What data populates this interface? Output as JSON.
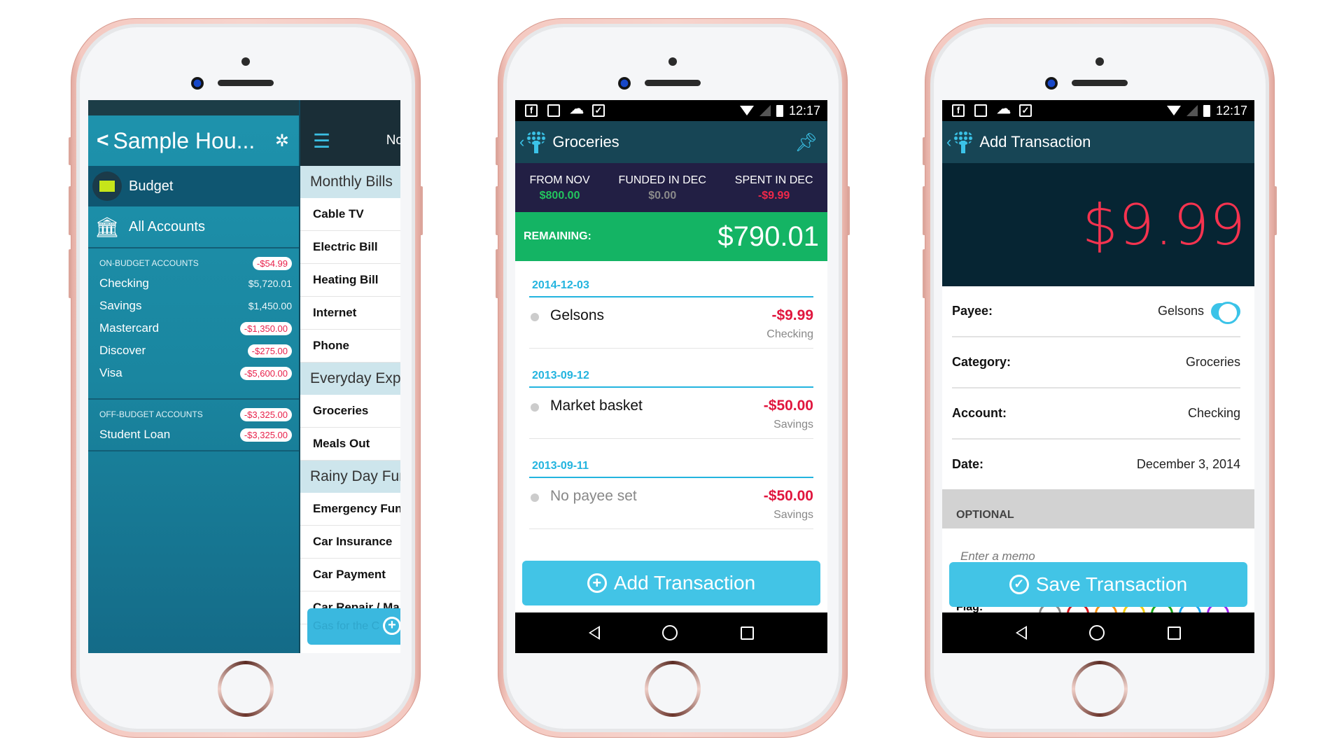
{
  "phone1": {
    "header_title": "Sample Hou...",
    "back_glyph": "<",
    "settings_icon": "gear-icon",
    "nav": [
      {
        "label": "Budget",
        "icon": "envelope-icon",
        "active": true
      },
      {
        "label": "All Accounts",
        "icon": "bank-icon",
        "active": false
      }
    ],
    "on_budget": {
      "heading": "ON-BUDGET ACCOUNTS",
      "total": "-$54.99",
      "accounts": [
        {
          "name": "Checking",
          "balance": "$5,720.01",
          "negative": false
        },
        {
          "name": "Savings",
          "balance": "$1,450.00",
          "negative": false
        },
        {
          "name": "Mastercard",
          "balance": "-$1,350.00",
          "negative": true
        },
        {
          "name": "Discover",
          "balance": "-$275.00",
          "negative": true
        },
        {
          "name": "Visa",
          "balance": "-$5,600.00",
          "negative": true
        }
      ]
    },
    "off_budget": {
      "heading": "OFF-BUDGET ACCOUNTS",
      "total": "-$3,325.00",
      "accounts": [
        {
          "name": "Student Loan",
          "balance": "-$3,325.00",
          "negative": true
        }
      ]
    },
    "right_panel": {
      "header_text": "No",
      "menu_icon": "hamburger-icon",
      "groups": [
        {
          "label": "Monthly Bills",
          "items": [
            "Cable TV",
            "Electric Bill",
            "Heating Bill",
            "Internet",
            "Phone"
          ]
        },
        {
          "label": "Everyday Expe",
          "items": [
            "Groceries",
            "Meals Out"
          ]
        },
        {
          "label": "Rainy Day Fun",
          "items": [
            "Emergency Fun",
            "Car Insurance",
            "Car Payment",
            "Car Repair / Ma"
          ]
        }
      ],
      "add_input_placeholder": "Gas for the C",
      "add_icon": "plus-circle-icon"
    }
  },
  "phone2": {
    "status": {
      "icons": [
        "facebook-icon",
        "image-icon",
        "cloud-upload-icon",
        "clipboard-check-icon"
      ],
      "time": "12:17"
    },
    "appbar_title": "Groceries",
    "pin_icon": "pin-icon",
    "stats": [
      {
        "label": "FROM NOV",
        "value": "$800.00",
        "color": "#22c55e"
      },
      {
        "label": "FUNDED IN DEC",
        "value": "$0.00",
        "color": "#8a8a8a"
      },
      {
        "label": "SPENT IN DEC",
        "value": "-$9.99",
        "color": "#f0284a"
      }
    ],
    "remaining_label": "REMAINING:",
    "remaining_value": "$790.01",
    "transactions": [
      {
        "date": "2014-12-03",
        "payee": "Gelsons",
        "amount": "-$9.99",
        "account": "Checking",
        "no_payee": false
      },
      {
        "date": "2013-09-12",
        "payee": "Market basket",
        "amount": "-$50.00",
        "account": "Savings",
        "no_payee": false
      },
      {
        "date": "2013-09-11",
        "payee": "No payee set",
        "amount": "-$50.00",
        "account": "Savings",
        "no_payee": true
      }
    ],
    "add_button": "Add Transaction"
  },
  "phone3": {
    "status": {
      "icons": [
        "facebook-icon",
        "image-icon",
        "cloud-upload-icon",
        "clipboard-check-icon"
      ],
      "time": "12:17"
    },
    "appbar_title": "Add Transaction",
    "amount": "$9.99",
    "fields": [
      {
        "label": "Payee:",
        "value": "Gelsons"
      },
      {
        "label": "Category:",
        "value": "Groceries"
      },
      {
        "label": "Account:",
        "value": "Checking"
      },
      {
        "label": "Date:",
        "value": "December 3, 2014"
      }
    ],
    "optional_heading": "OPTIONAL",
    "memo_placeholder": "Enter a memo",
    "flag_label": "Flag:",
    "flag_colors": [
      "#888888",
      "#d4141c",
      "#f39012",
      "#f2cc0c",
      "#1aa81a",
      "#1aa4f0",
      "#9b22f0"
    ],
    "save_button": "Save Transaction"
  },
  "colors": {
    "accent": "#42c4e6",
    "negative": "#e0163e",
    "remaining_green": "#14b464",
    "appbar": "#174555"
  }
}
